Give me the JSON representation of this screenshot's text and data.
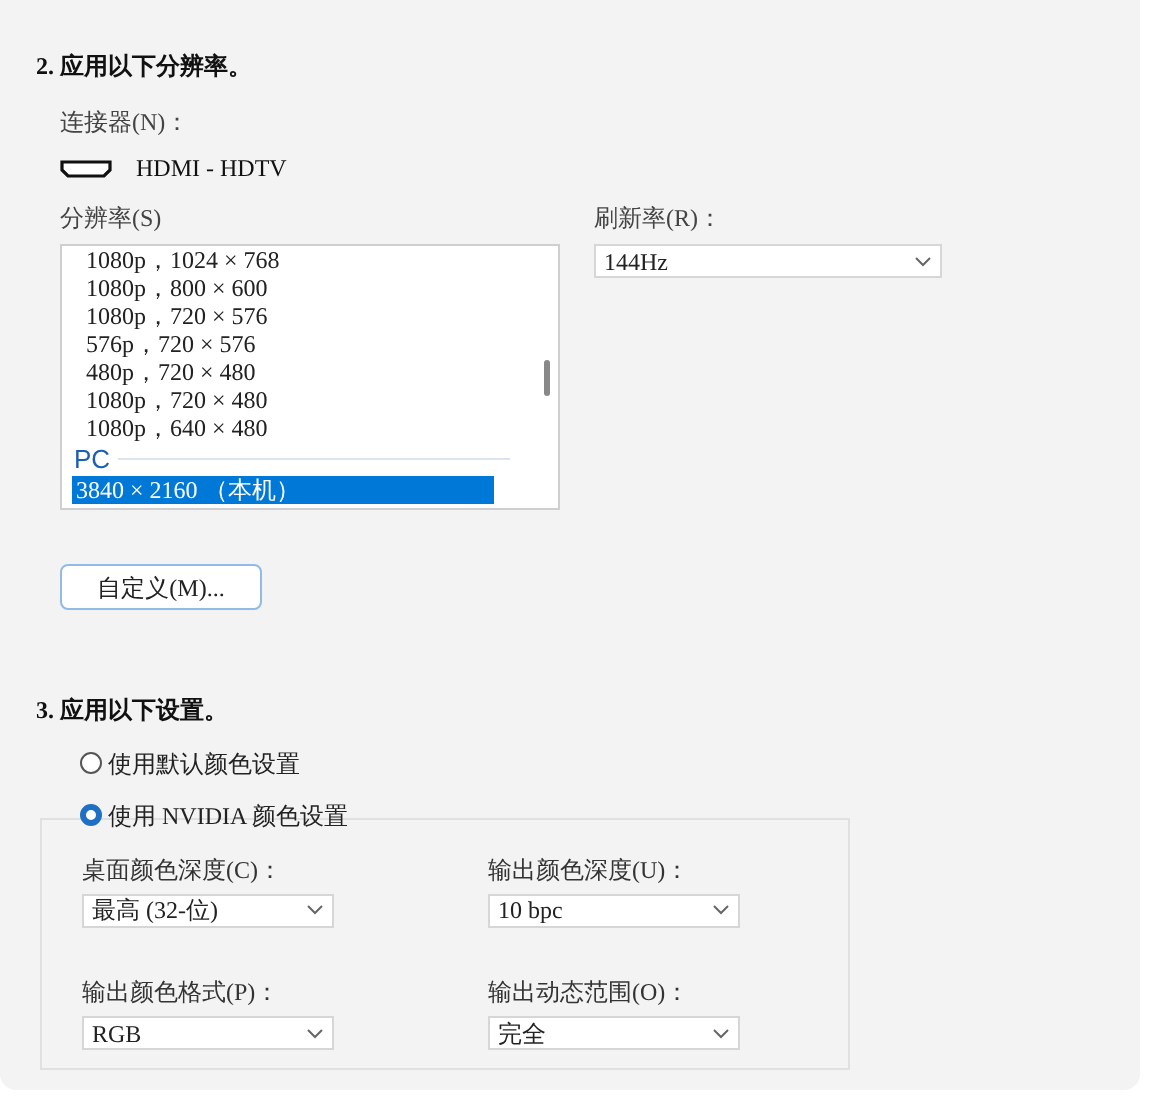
{
  "resolution_section": {
    "heading": "2. 应用以下分辨率。",
    "connector_label": "连接器(N)：",
    "connector": "HDMI - HDTV",
    "resolution_label": "分辨率(S)",
    "resolutions": [
      {
        "kind": "item",
        "label": "1080p，1024 × 768",
        "selected": false
      },
      {
        "kind": "item",
        "label": "1080p，800 × 600",
        "selected": false
      },
      {
        "kind": "item",
        "label": "1080p，720 × 576",
        "selected": false
      },
      {
        "kind": "item",
        "label": "576p，720 × 576",
        "selected": false
      },
      {
        "kind": "item",
        "label": "480p，720 × 480",
        "selected": false
      },
      {
        "kind": "item",
        "label": "1080p，720 × 480",
        "selected": false
      },
      {
        "kind": "item",
        "label": "1080p，640 × 480",
        "selected": false
      },
      {
        "kind": "group",
        "label": "PC"
      },
      {
        "kind": "item",
        "label": "3840 × 2160 （本机）",
        "selected": true
      }
    ],
    "refresh_label": "刷新率(R)：",
    "refresh_value": "144Hz",
    "custom_button": "自定义(M)..."
  },
  "settings_section": {
    "heading": "3. 应用以下设置。",
    "options": [
      {
        "label": "使用默认颜色设置",
        "selected": false
      },
      {
        "label": "使用 NVIDIA 颜色设置",
        "selected": true
      }
    ],
    "fields": [
      {
        "label": "桌面颜色深度(C)：",
        "value": "最高 (32-位)"
      },
      {
        "label": "输出颜色深度(U)：",
        "value": "10 bpc"
      },
      {
        "label": "输出颜色格式(P)：",
        "value": "RGB"
      },
      {
        "label": "输出动态范围(O)：",
        "value": "完全"
      }
    ]
  }
}
